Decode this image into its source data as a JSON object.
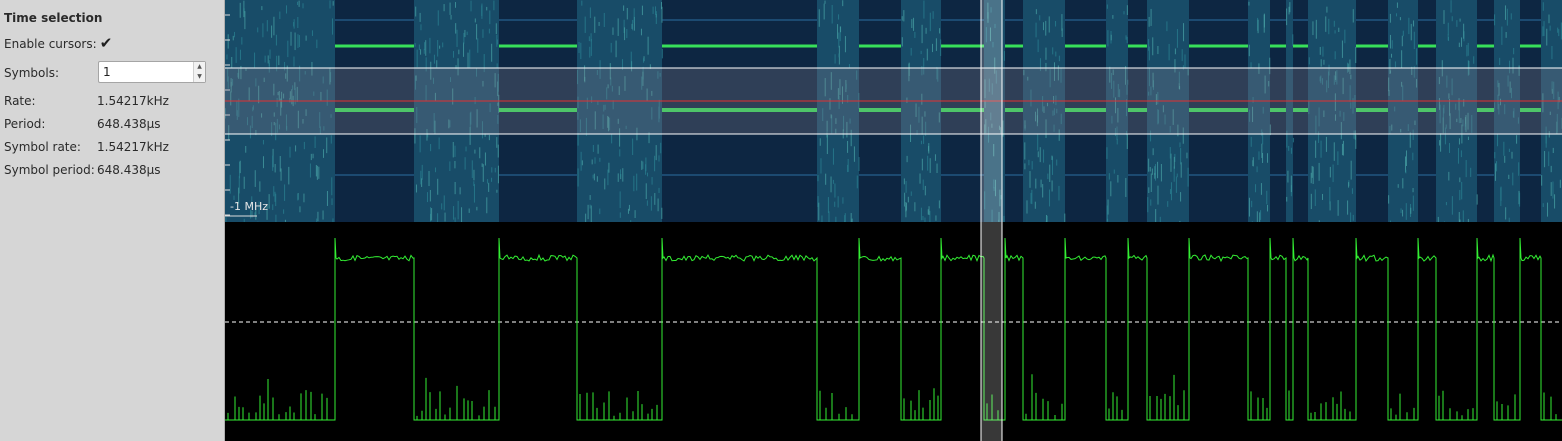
{
  "panel": {
    "title": "Time selection",
    "enable_cursors_label": "Enable cursors:",
    "enable_cursors_checked": true,
    "symbols_label": "Symbols:",
    "symbols_value": "1",
    "rate_label": "Rate:",
    "rate_value": "1.54217kHz",
    "period_label": "Period:",
    "period_value": "648.438µs",
    "symbol_rate_label": "Symbol rate:",
    "symbol_rate_value": "1.54217kHz",
    "symbol_period_label": "Symbol period:",
    "symbol_period_value": "648.438µs"
  },
  "spectrogram": {
    "freq_label": "-1 MHz",
    "background_color": "#0d2642",
    "signal_color": "#38e05a"
  },
  "waveform": {
    "trace_color": "#33ee33"
  }
}
